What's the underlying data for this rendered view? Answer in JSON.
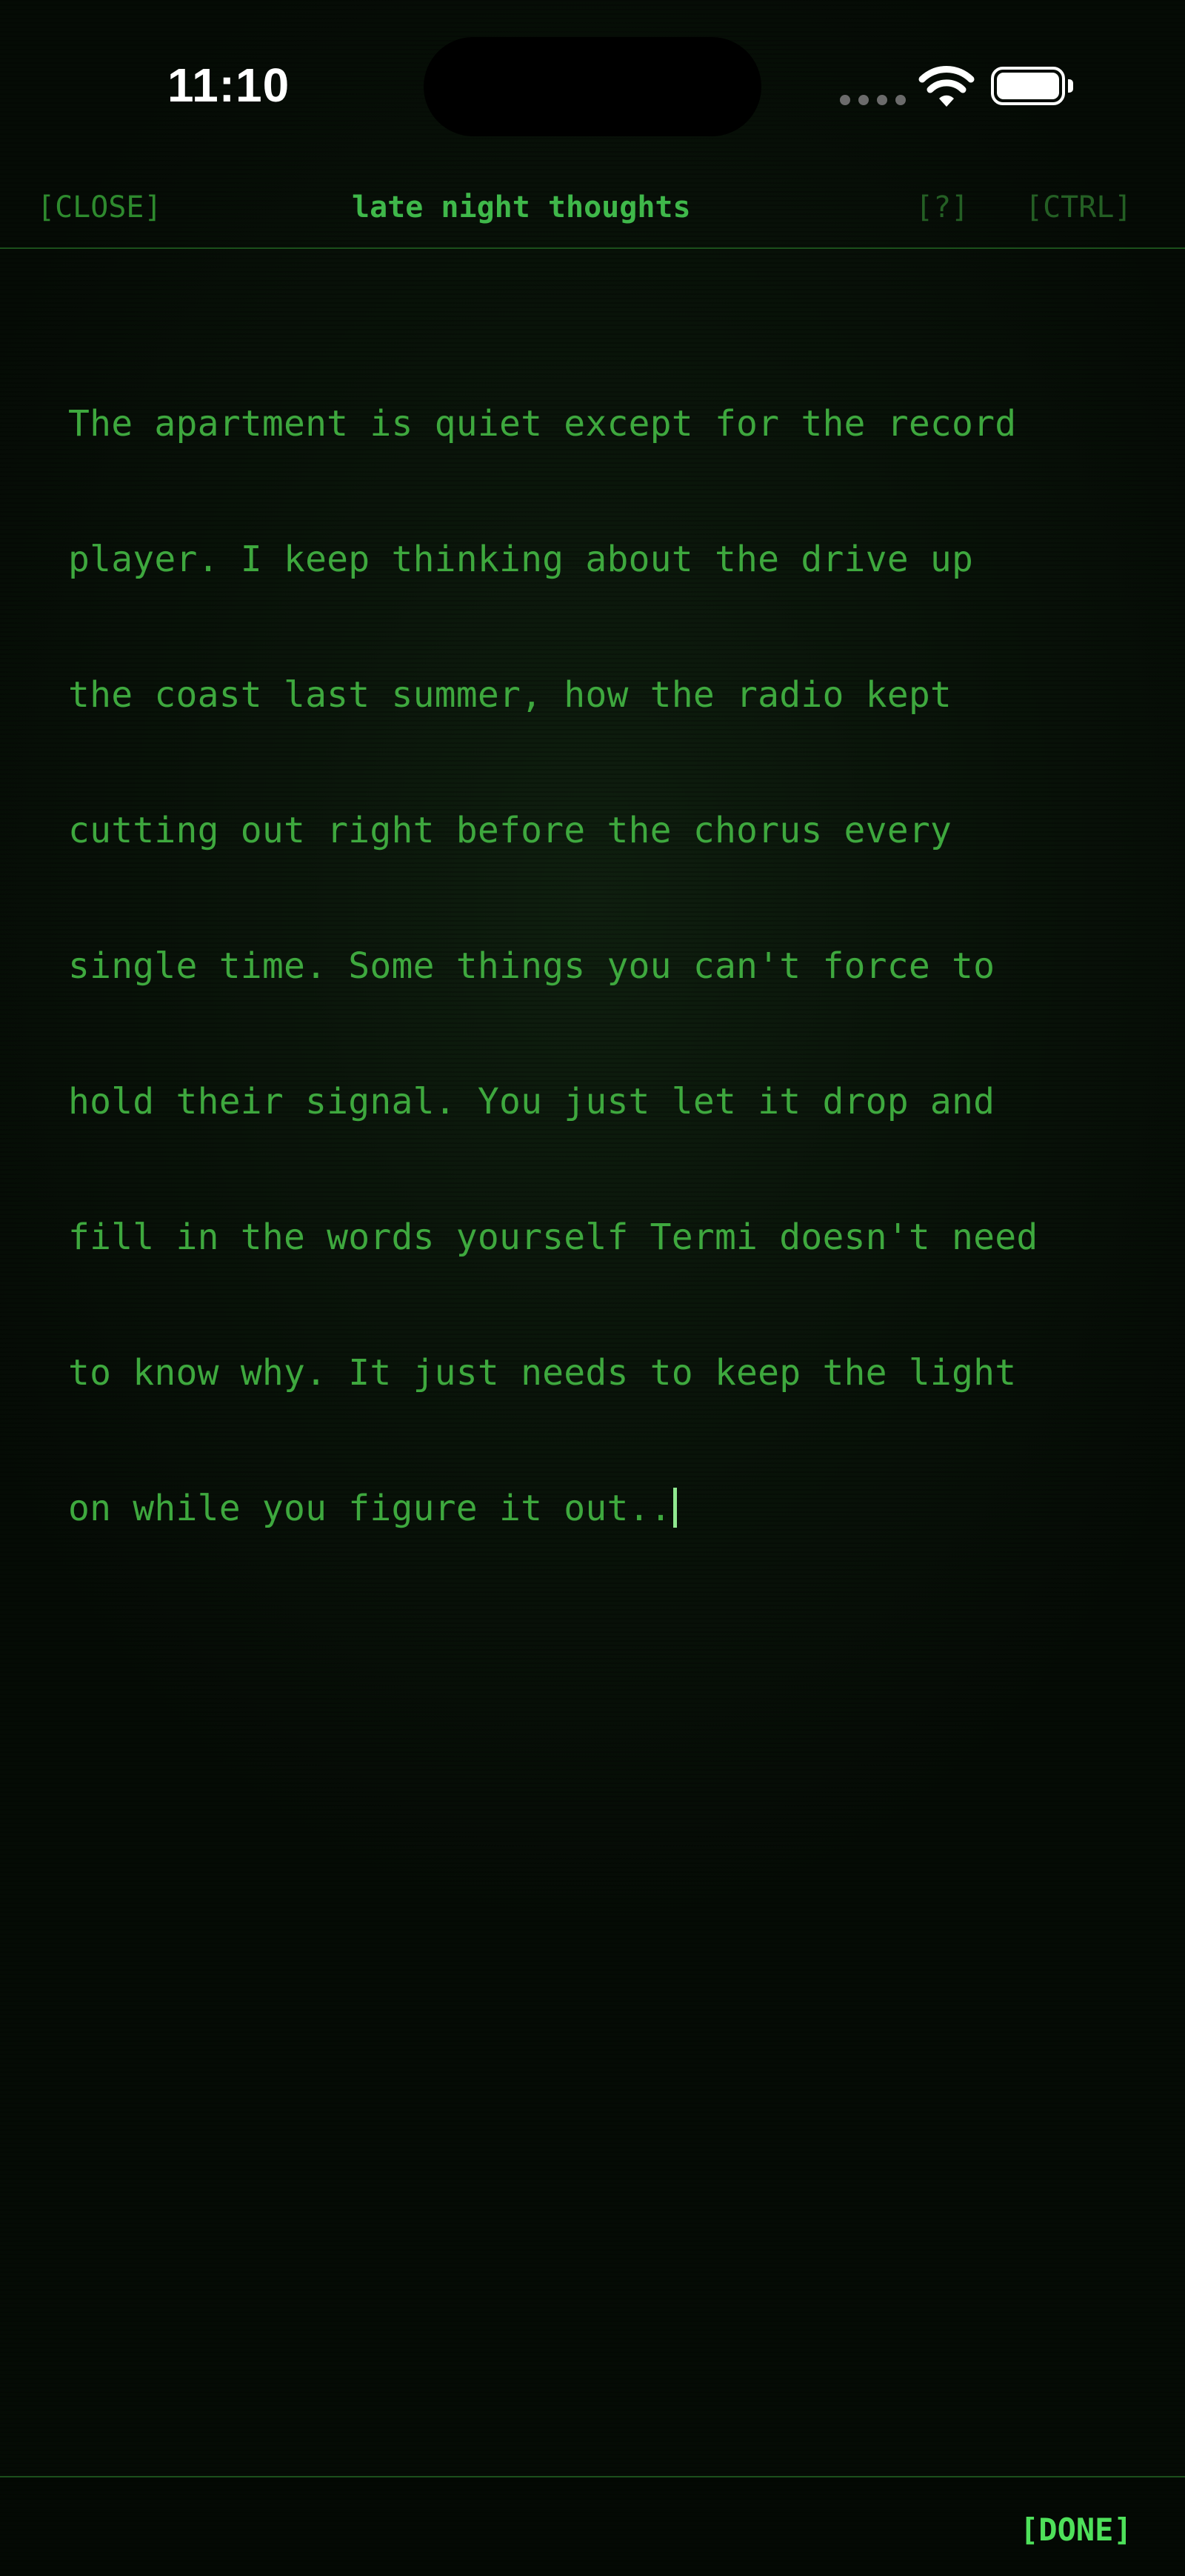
{
  "status_bar": {
    "time": "11:10"
  },
  "header": {
    "close_label": "[CLOSE]",
    "title": "late night thoughts",
    "help_label": "[?]",
    "ctrl_label": "[CTRL]"
  },
  "editor": {
    "lines": [
      "The apartment is quiet except for the record",
      "player. I keep thinking about the drive up",
      "the coast last summer, how the radio kept",
      "cutting out right before the chorus every",
      "single time. Some things you can't force to",
      "hold their signal. You just let it drop and",
      "fill in the words yourself Termi doesn't need",
      "to know why. It just needs to keep the light",
      "on while you figure it out.."
    ]
  },
  "footer": {
    "done_label": "[DONE]"
  },
  "icons": {
    "signal": "cellular-signal-icon",
    "wifi": "wifi-icon",
    "battery": "battery-icon",
    "cursor": "text-cursor-icon"
  },
  "colors": {
    "background": "#050a05",
    "terminal_green": "#3ea83e",
    "accent_green": "#4ee05a",
    "dim_green": "#245f24",
    "divider": "#1b4f1b"
  }
}
